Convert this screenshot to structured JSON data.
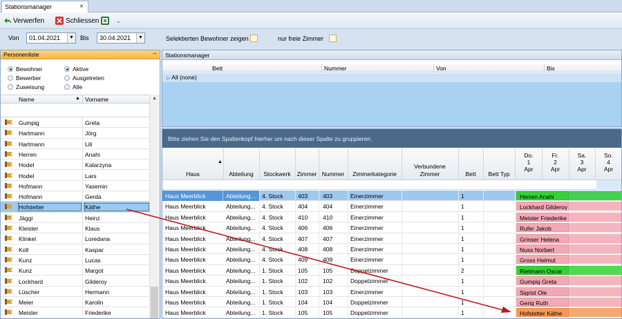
{
  "tab": {
    "label": "Stationsmanager",
    "close": "×"
  },
  "toolbar": {
    "discard": "Verwerfen",
    "close": "Schliessen",
    "more": "⌄"
  },
  "filter": {
    "from_label": "Von",
    "from_value": "01.04.2021",
    "to_label": "Bis",
    "to_value": "30.04.2021",
    "show_selected_label": "Selektierten Bewohner zeigen",
    "free_rooms_label": "nur freie Zimmer"
  },
  "left": {
    "title": "Personenliste",
    "radios": {
      "bewohner": "Bewohner",
      "bewerber": "Bewerber",
      "zuweisung": "Zuweisung",
      "aktive": "Aktive",
      "ausgetreten": "Ausgetreten",
      "alle": "Alle"
    },
    "col_name": "Name",
    "col_vorname": "Vorname",
    "rows": [
      {
        "name": "Gumpig",
        "vorname": "Greta"
      },
      {
        "name": "Hartmann",
        "vorname": "Jörg"
      },
      {
        "name": "Hartmann",
        "vorname": "Lili"
      },
      {
        "name": "Herren",
        "vorname": "Anahi"
      },
      {
        "name": "Hodel",
        "vorname": "Katarzyna"
      },
      {
        "name": "Hodel",
        "vorname": "Lars"
      },
      {
        "name": "Hofmann",
        "vorname": "Yasemin"
      },
      {
        "name": "Hofmann",
        "vorname": "Gerda"
      },
      {
        "name": "Hofstetter",
        "vorname": "Käthe"
      },
      {
        "name": "Jäggi",
        "vorname": "Heinz"
      },
      {
        "name": "Kleister",
        "vorname": "Klaus"
      },
      {
        "name": "Klinkel",
        "vorname": "Loredana"
      },
      {
        "name": "Koll",
        "vorname": "Kaspar"
      },
      {
        "name": "Kunz",
        "vorname": "Lucas"
      },
      {
        "name": "Kunz",
        "vorname": "Margot"
      },
      {
        "name": "Lockhard",
        "vorname": "Gilderoy"
      },
      {
        "name": "Lüscher",
        "vorname": "Hermann"
      },
      {
        "name": "Meier",
        "vorname": "Karolin"
      },
      {
        "name": "Meister",
        "vorname": "Friederike"
      }
    ]
  },
  "right_top": {
    "title": "Stationsmanager",
    "col_bett": "Bett",
    "col_nummer": "Nummer",
    "col_von": "Von",
    "col_bis": "Bis",
    "all_row": "All  (none)"
  },
  "right_bottom": {
    "group_hint": "Bitte ziehen Sie den Spaltenkopf hierher um nach dieser Spalte zu gruppieren.",
    "headers": {
      "haus": "Haus",
      "abteilung": "Abteilung",
      "stockwerk": "Stockwerk",
      "zimmer": "Zimmer",
      "nummer": "Nummer",
      "zimmerkategorie": "Zimmerkategorie",
      "verbundene1": "Verbundene",
      "verbundene2": "Zimmer",
      "bett": "Bett",
      "betttyp": "Bett Typ"
    },
    "days": [
      {
        "d": "Do.",
        "n": "1",
        "m": "Apr"
      },
      {
        "d": "Fr.",
        "n": "2",
        "m": "Apr"
      },
      {
        "d": "Sa.",
        "n": "3",
        "m": "Apr"
      },
      {
        "d": "So.",
        "n": "4",
        "m": "Apr"
      }
    ],
    "rows": [
      {
        "haus": "Haus Meerblick",
        "abt": "Abteilung...",
        "stock": "4. Stock",
        "zimmer": "403",
        "nummer": "403",
        "kat": "Einerzimmer",
        "bett": "1",
        "occ": "Herren Anahi",
        "color": "#35d135",
        "sel": true
      },
      {
        "haus": "Haus Meerblick",
        "abt": "Abteilung...",
        "stock": "4. Stock",
        "zimmer": "404",
        "nummer": "404",
        "kat": "Einerzimmer",
        "bett": "1",
        "occ": "Lockhard Gilderoy",
        "color": "#f3a8b4"
      },
      {
        "haus": "Haus Meerblick",
        "abt": "Abteilung...",
        "stock": "4. Stock",
        "zimmer": "410",
        "nummer": "410",
        "kat": "Einerzimmer",
        "bett": "1",
        "occ": "Meister Friederike",
        "color": "#f3a8b4"
      },
      {
        "haus": "Haus Meerblick",
        "abt": "Abteilung...",
        "stock": "4. Stock",
        "zimmer": "406",
        "nummer": "406",
        "kat": "Einerzimmer",
        "bett": "1",
        "occ": "Rufer Jakob",
        "color": "#f3a8b4"
      },
      {
        "haus": "Haus Meerblick",
        "abt": "Abteilung...",
        "stock": "4. Stock",
        "zimmer": "407",
        "nummer": "407",
        "kat": "Einerzimmer",
        "bett": "1",
        "occ": "Grinser Helena",
        "color": "#f3a8b4"
      },
      {
        "haus": "Haus Meerblick",
        "abt": "Abteilung...",
        "stock": "4. Stock",
        "zimmer": "408",
        "nummer": "408",
        "kat": "Einerzimmer",
        "bett": "1",
        "occ": "Nuss Norbert",
        "color": "#f3a8b4"
      },
      {
        "haus": "Haus Meerblick",
        "abt": "Abteilung...",
        "stock": "4. Stock",
        "zimmer": "409",
        "nummer": "409",
        "kat": "Einerzimmer",
        "bett": "1",
        "occ": "Gross Helmut",
        "color": "#f3a8b4"
      },
      {
        "haus": "Haus Meerblick",
        "abt": "Abteilung...",
        "stock": "1. Stock",
        "zimmer": "105",
        "nummer": "105",
        "kat": "Doppelzimmer",
        "bett": "2",
        "occ": "Rietmann Oscar",
        "color": "#35d135"
      },
      {
        "haus": "Haus Meerblick",
        "abt": "Abteilung...",
        "stock": "1. Stock",
        "zimmer": "102",
        "nummer": "102",
        "kat": "Doppelzimmer",
        "bett": "1",
        "occ": "Gumpig Greta",
        "color": "#f3a8b4"
      },
      {
        "haus": "Haus Meerblick",
        "abt": "Abteilung...",
        "stock": "1. Stock",
        "zimmer": "103",
        "nummer": "103",
        "kat": "Einerzimmer",
        "bett": "1",
        "occ": "Sigrist Ole",
        "color": "#f3a8b4"
      },
      {
        "haus": "Haus Meerblick",
        "abt": "Abteilung...",
        "stock": "1. Stock",
        "zimmer": "104",
        "nummer": "104",
        "kat": "Doppelzimmer",
        "bett": "1",
        "occ": "Gerig Ruth",
        "color": "#f3a8b4"
      },
      {
        "haus": "Haus Meerblick",
        "abt": "Abteilung...",
        "stock": "1. Stock",
        "zimmer": "105",
        "nummer": "105",
        "kat": "Doppelzimmer",
        "bett": "1",
        "occ": "Hofstetter Käthe",
        "color": "#f59a55"
      }
    ]
  },
  "colors": {
    "accent": "#4b6a8b",
    "selection": "#9ec9ef",
    "arrow": "#c0161a",
    "header_orange": "#f6b645"
  }
}
